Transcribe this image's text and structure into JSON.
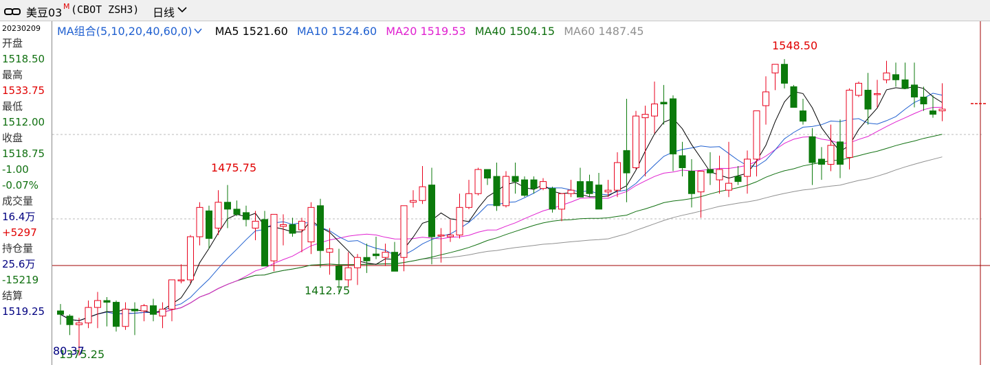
{
  "header": {
    "symbol": "美豆03",
    "superscript": "M",
    "exchange_code": "(CBOT ZSH3)",
    "period": "日线"
  },
  "info_panel": {
    "date": "20230209",
    "open_label": "开盘",
    "open": "1518.50",
    "high_label": "最高",
    "high": "1533.75",
    "low_label": "最低",
    "low": "1512.00",
    "close_label": "收盘",
    "close": "1518.75",
    "change": "-1.00",
    "change_pct": "-0.07%",
    "volume_label": "成交量",
    "volume": "16.4万",
    "volume_change": "+5297",
    "oi_label": "持仓量",
    "oi": "25.6万",
    "oi_change": "-15219",
    "settle_label": "结算",
    "settle": "1519.25"
  },
  "ma_bar": {
    "combo_label": "MA组合(5,10,20,40,60,0)",
    "ma5": "MA5 1521.60",
    "ma10": "MA10 1524.60",
    "ma20": "MA20 1519.53",
    "ma40": "MA40 1504.15",
    "ma60": "MA60 1487.45"
  },
  "annotations": {
    "high1": "1475.75",
    "low1": "1412.75",
    "high2": "1548.50",
    "low0": "1375.25",
    "left_value": "80.37"
  },
  "colors": {
    "up": "#e8001c",
    "down": "#0b7a0b",
    "ma5": "#000000",
    "ma10": "#2060d0",
    "ma20": "#e020d0",
    "ma40": "#107010",
    "ma60": "#909090",
    "price_label_red": "#e00000",
    "price_label_green": "#107010",
    "navy": "#000080"
  },
  "chart_data": {
    "type": "candlestick",
    "title": "",
    "ylim": [
      1375,
      1560
    ],
    "grid": true,
    "candles": [
      [
        1402,
        1406,
        1394,
        1400
      ],
      [
        1399,
        1400,
        1388,
        1394
      ],
      [
        1394,
        1398,
        1376,
        1395
      ],
      [
        1395,
        1408,
        1392,
        1404
      ],
      [
        1404,
        1413,
        1392,
        1408
      ],
      [
        1408,
        1410,
        1393,
        1407
      ],
      [
        1407,
        1408,
        1390,
        1393
      ],
      [
        1393,
        1407,
        1391,
        1403
      ],
      [
        1403,
        1407,
        1388,
        1402
      ],
      [
        1402,
        1406,
        1396,
        1405
      ],
      [
        1405,
        1409,
        1396,
        1400
      ],
      [
        1399,
        1407,
        1392,
        1403
      ],
      [
        1403,
        1419,
        1396,
        1420
      ],
      [
        1420,
        1429,
        1418,
        1420
      ],
      [
        1420,
        1446,
        1418,
        1445
      ],
      [
        1445,
        1465,
        1440,
        1462
      ],
      [
        1460,
        1463,
        1438,
        1444
      ],
      [
        1450,
        1472,
        1446,
        1465
      ],
      [
        1465,
        1475,
        1450,
        1461
      ],
      [
        1461,
        1466,
        1457,
        1458
      ],
      [
        1459,
        1463,
        1451,
        1455
      ],
      [
        1450,
        1460,
        1443,
        1454
      ],
      [
        1455,
        1460,
        1432,
        1428
      ],
      [
        1431,
        1458,
        1425,
        1458
      ],
      [
        1451,
        1458,
        1440,
        1452
      ],
      [
        1452,
        1456,
        1445,
        1447
      ],
      [
        1449,
        1456,
        1436,
        1454
      ],
      [
        1442,
        1465,
        1435,
        1462
      ],
      [
        1463,
        1467,
        1427,
        1437
      ],
      [
        1436,
        1450,
        1423,
        1438
      ],
      [
        1428,
        1438,
        1413,
        1420
      ],
      [
        1420,
        1436,
        1416,
        1427
      ],
      [
        1427,
        1435,
        1417,
        1433
      ],
      [
        1433,
        1441,
        1424,
        1431
      ],
      [
        1435,
        1445,
        1432,
        1434
      ],
      [
        1433,
        1441,
        1428,
        1436
      ],
      [
        1436,
        1442,
        1425,
        1425
      ],
      [
        1433,
        1457,
        1425,
        1463
      ],
      [
        1465,
        1472,
        1462,
        1466
      ],
      [
        1466,
        1486,
        1464,
        1474
      ],
      [
        1475,
        1485,
        1429,
        1445
      ],
      [
        1446,
        1450,
        1430,
        1446
      ],
      [
        1445,
        1455,
        1442,
        1446
      ],
      [
        1446,
        1470,
        1444,
        1462
      ],
      [
        1462,
        1478,
        1461,
        1470
      ],
      [
        1470,
        1485,
        1469,
        1484
      ],
      [
        1484,
        1482,
        1475,
        1479
      ],
      [
        1480,
        1488,
        1460,
        1463
      ],
      [
        1463,
        1483,
        1462,
        1480
      ],
      [
        1480,
        1488,
        1470,
        1477
      ],
      [
        1478,
        1480,
        1468,
        1469
      ],
      [
        1478,
        1480,
        1470,
        1473
      ],
      [
        1473,
        1479,
        1472,
        1477
      ],
      [
        1473,
        1474,
        1459,
        1461
      ],
      [
        1461,
        1470,
        1454,
        1470
      ],
      [
        1470,
        1478,
        1468,
        1472
      ],
      [
        1477,
        1485,
        1470,
        1468
      ],
      [
        1477,
        1481,
        1468,
        1470
      ],
      [
        1475,
        1482,
        1462,
        1461
      ],
      [
        1471,
        1478,
        1468,
        1472
      ],
      [
        1472,
        1494,
        1468,
        1488
      ],
      [
        1495,
        1525,
        1465,
        1482
      ],
      [
        1485,
        1518,
        1484,
        1515
      ],
      [
        1514,
        1521,
        1480,
        1516
      ],
      [
        1515,
        1535,
        1505,
        1522
      ],
      [
        1523,
        1533,
        1510,
        1522
      ],
      [
        1525,
        1527,
        1483,
        1493
      ],
      [
        1492,
        1500,
        1480,
        1485
      ],
      [
        1483,
        1490,
        1462,
        1470
      ],
      [
        1471,
        1478,
        1456,
        1483
      ],
      [
        1484,
        1494,
        1475,
        1482
      ],
      [
        1478,
        1492,
        1470,
        1484
      ],
      [
        1472,
        1500,
        1468,
        1476
      ],
      [
        1480,
        1486,
        1475,
        1477
      ],
      [
        1480,
        1495,
        1470,
        1490
      ],
      [
        1490,
        1500,
        1480,
        1518
      ],
      [
        1521,
        1538,
        1510,
        1529
      ],
      [
        1540,
        1545,
        1530,
        1545
      ],
      [
        1545,
        1548,
        1531,
        1534
      ],
      [
        1532,
        1533,
        1520,
        1520
      ],
      [
        1518,
        1525,
        1510,
        1512
      ],
      [
        1503,
        1508,
        1475,
        1488
      ],
      [
        1490,
        1497,
        1478,
        1487
      ],
      [
        1487,
        1510,
        1483,
        1498
      ],
      [
        1500,
        1513,
        1479,
        1487
      ],
      [
        1491,
        1531,
        1484,
        1530
      ],
      [
        1527,
        1535,
        1526,
        1534
      ],
      [
        1530,
        1540,
        1510,
        1519
      ],
      [
        1528,
        1536,
        1520,
        1528
      ],
      [
        1536,
        1547,
        1534,
        1540
      ],
      [
        1539,
        1546,
        1532,
        1536
      ],
      [
        1536,
        1546,
        1532,
        1531
      ],
      [
        1533,
        1546,
        1520,
        1526
      ],
      [
        1526,
        1532,
        1518,
        1522
      ],
      [
        1518,
        1527,
        1514,
        1516
      ],
      [
        1518,
        1534,
        1512,
        1519
      ]
    ],
    "ma_last": {
      "MA5": 1521.6,
      "MA10": 1524.6,
      "MA20": 1519.53,
      "MA40": 1504.15,
      "MA60": 1487.45
    }
  }
}
